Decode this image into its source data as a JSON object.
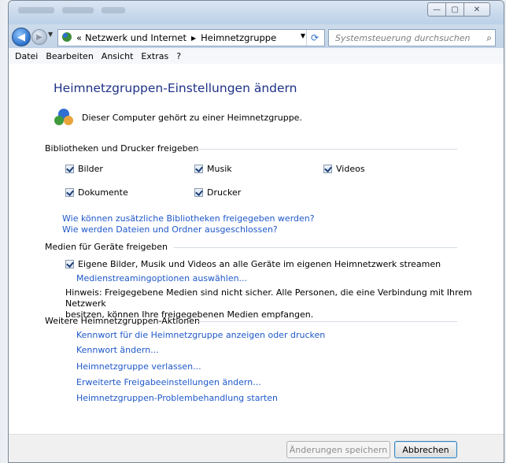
{
  "window": {
    "min_glyph": "—",
    "max_glyph": "▢",
    "close_glyph": "✕"
  },
  "nav": {
    "back_glyph": "◀",
    "forward_glyph": "▶",
    "address_prefix": "«",
    "breadcrumb": [
      "Netzwerk und Internet",
      "Heimnetzgruppe"
    ],
    "search_placeholder": "Systemsteuerung durchsuchen"
  },
  "menu": [
    "Datei",
    "Bearbeiten",
    "Ansicht",
    "Extras",
    "?"
  ],
  "page": {
    "title": "Heimnetzgruppen-Einstellungen ändern",
    "membership_text": "Dieser Computer gehört zu einer Heimnetzgruppe."
  },
  "libraries": {
    "heading": "Bibliotheken und Drucker freigeben",
    "items": [
      {
        "label": "Bilder",
        "checked": true
      },
      {
        "label": "Musik",
        "checked": true
      },
      {
        "label": "Videos",
        "checked": true
      },
      {
        "label": "Dokumente",
        "checked": true
      },
      {
        "label": "Drucker",
        "checked": true
      }
    ],
    "links": [
      "Wie können zusätzliche Bibliotheken freigegeben werden?",
      "Wie werden Dateien und Ordner ausgeschlossen?"
    ]
  },
  "media": {
    "heading": "Medien für Geräte freigeben",
    "stream_label": "Eigene Bilder, Musik und Videos an alle Geräte im eigenen Heimnetzwerk streamen",
    "stream_checked": true,
    "options_link": "Medienstreamingoptionen auswählen...",
    "note_line1": "Hinweis: Freigegebene Medien sind nicht sicher. Alle Personen, die eine Verbindung mit Ihrem Netzwerk",
    "note_line2": "besitzen, können Ihre freigegebenen Medien empfangen."
  },
  "actions": {
    "heading": "Weitere Heimnetzgruppen-Aktionen",
    "links": [
      "Kennwort für die Heimnetzgruppe anzeigen oder drucken",
      "Kennwort ändern...",
      "Heimnetzgruppe verlassen...",
      "Erweiterte Freigabeeinstellungen ändern...",
      "Heimnetzgruppen-Problembehandlung starten"
    ]
  },
  "buttons": {
    "save": "Änderungen speichern",
    "cancel": "Abbrechen"
  },
  "colors": {
    "title": "#1e3287",
    "link": "#1f58c9"
  }
}
